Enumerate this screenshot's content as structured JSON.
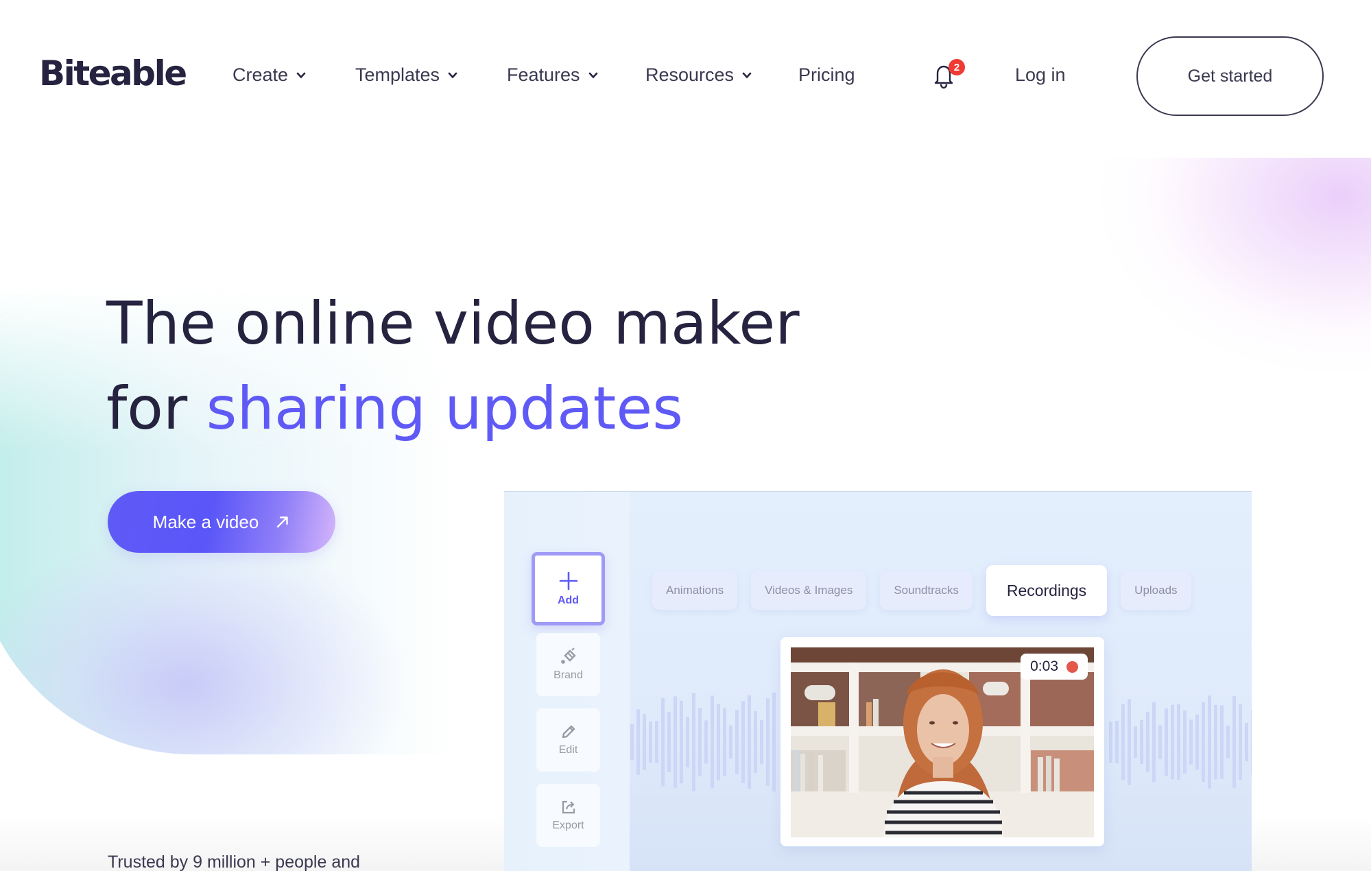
{
  "brand": {
    "name": "Biteable",
    "accent_color": "#5f5af6",
    "text_color": "#25233f"
  },
  "nav": {
    "items": [
      {
        "label": "Create",
        "has_dropdown": true,
        "icon": "chevron-down-icon"
      },
      {
        "label": "Templates",
        "has_dropdown": true,
        "icon": "chevron-down-icon"
      },
      {
        "label": "Features",
        "has_dropdown": true,
        "icon": "chevron-down-icon"
      },
      {
        "label": "Resources",
        "has_dropdown": true,
        "icon": "chevron-down-icon"
      },
      {
        "label": "Pricing",
        "has_dropdown": false
      }
    ],
    "notifications": {
      "icon": "bell-icon",
      "count": "2",
      "badge_color": "#ef3b33"
    },
    "login_label": "Log in",
    "get_started_label": "Get started"
  },
  "hero": {
    "title_line1": "The online video maker",
    "title_line2_prefix": "for",
    "title_line2_accent": "sharing updates",
    "cta_label": "Make a video",
    "cta_icon": "arrow-up-right-icon",
    "trusted_text": "Trusted by 9 million + people and"
  },
  "mockup": {
    "tools": [
      {
        "label": "Add",
        "icon": "plus-icon",
        "active": true
      },
      {
        "label": "Brand",
        "icon": "paint-bucket-icon",
        "active": false
      },
      {
        "label": "Edit",
        "icon": "pencil-icon",
        "active": false
      },
      {
        "label": "Export",
        "icon": "export-icon",
        "active": false
      }
    ],
    "tabs": [
      {
        "label": "Animations",
        "active": false
      },
      {
        "label": "Videos & Images",
        "active": false
      },
      {
        "label": "Soundtracks",
        "active": false
      },
      {
        "label": "Recordings",
        "active": true
      },
      {
        "label": "Uploads",
        "active": false
      }
    ],
    "recording": {
      "timer": "0:03",
      "status": "recording",
      "dot_color": "#e4584b"
    }
  }
}
